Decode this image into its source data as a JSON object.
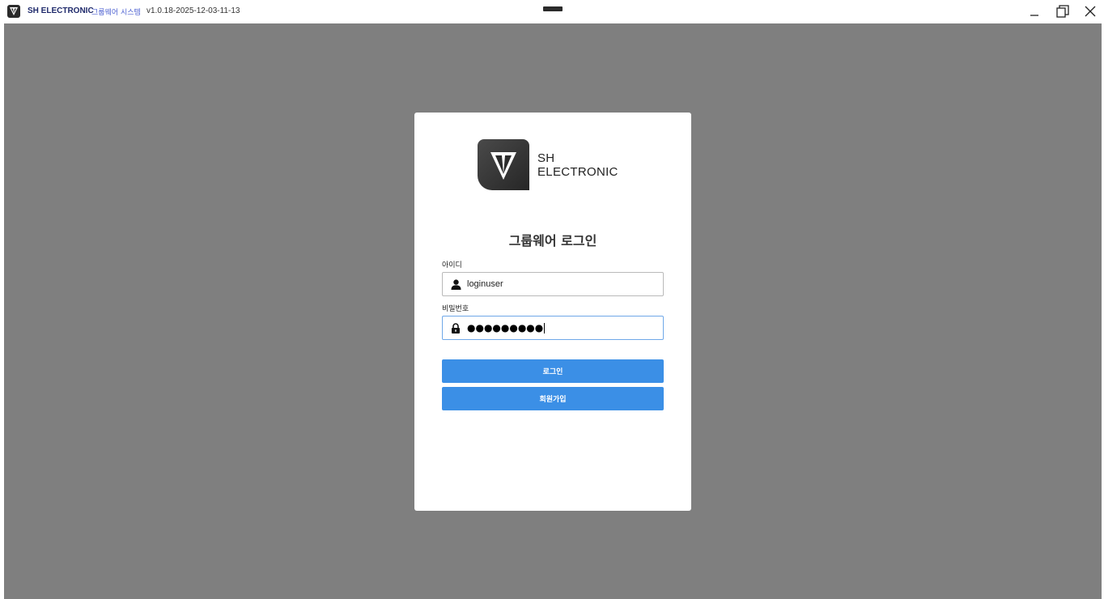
{
  "titlebar": {
    "app_name": "SH ELECTRONIC",
    "app_subtitle": "그룹웨어 시스템",
    "version": "v1.0.18-2025-12-03-11-13",
    "minimize_label": "_"
  },
  "brand": {
    "line1": "SH",
    "line2": "ELECTRONIC"
  },
  "login": {
    "title": "그룹웨어 로그인",
    "id_label": "아이디",
    "id_value": "loginuser",
    "password_label": "비밀번호",
    "password_mask": "●●●●●●●●●",
    "login_button": "로그인",
    "signup_button": "회원가입"
  },
  "colors": {
    "backdrop": "#7f7f7f",
    "primary_button": "#3b8fe6",
    "brand_text": "#1f2a6b"
  },
  "icons": {
    "app": "sh-logo-icon",
    "user_field": "user-icon",
    "password_field": "lock-icon",
    "minimize": "minimize-icon",
    "restore": "restore-icon",
    "close": "close-icon"
  }
}
